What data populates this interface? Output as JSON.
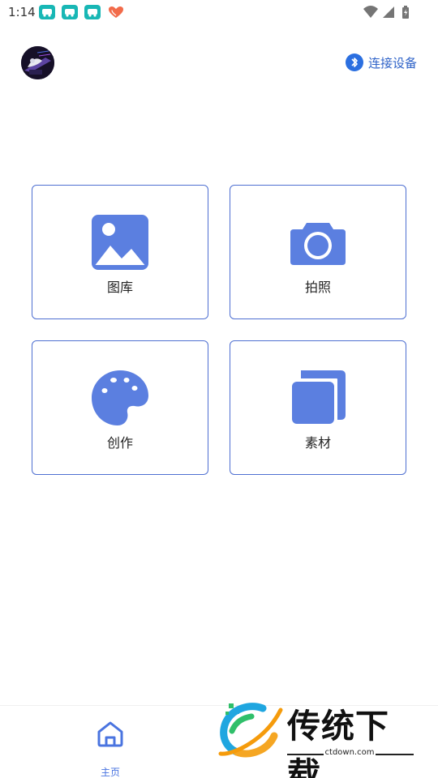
{
  "status_bar": {
    "time": "1:14",
    "icons": [
      "car-app-icon",
      "car-app-icon",
      "car-app-icon",
      "heart-hands-icon",
      "wifi-icon",
      "signal-icon",
      "battery-icon"
    ]
  },
  "header": {
    "avatar_icon": "avatar-image",
    "connect_label": "连接设备",
    "connect_icon": "bluetooth-icon"
  },
  "tiles": [
    {
      "label": "图库",
      "icon": "gallery-icon"
    },
    {
      "label": "拍照",
      "icon": "camera-icon"
    },
    {
      "label": "创作",
      "icon": "palette-icon"
    },
    {
      "label": "素材",
      "icon": "layers-icon"
    }
  ],
  "bottom_nav": {
    "items": [
      {
        "label": "主页",
        "icon": "home-icon"
      }
    ]
  },
  "colors": {
    "accent": "#5b7fe0",
    "tile_border": "#4e6fd1",
    "bluetooth": "#2b6fe0",
    "link_text": "#2f63c8"
  }
}
